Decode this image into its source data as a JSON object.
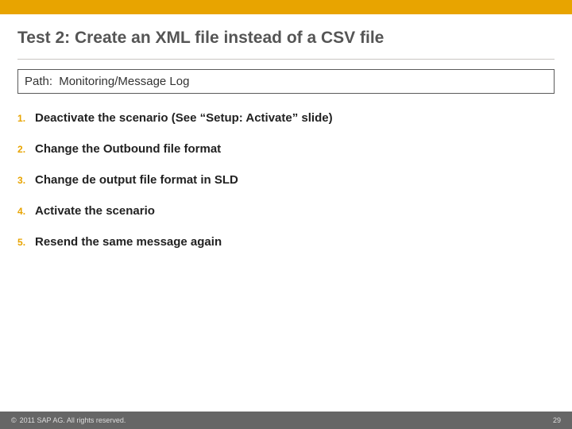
{
  "title": "Test 2: Create an XML file instead of a CSV file",
  "path": {
    "label": "Path:",
    "value": "Monitoring/Message Log"
  },
  "steps": [
    "Deactivate the scenario (See “Setup: Activate” slide)",
    "Change the Outbound file format",
    "Change de output file format in SLD",
    "Activate the scenario",
    "Resend the same message again"
  ],
  "footer": {
    "copyright_symbol": "©",
    "copyright_text": "2011 SAP AG. All rights reserved.",
    "page_number": "29"
  },
  "colors": {
    "accent": "#e8a400",
    "footer_bg": "#666666"
  }
}
